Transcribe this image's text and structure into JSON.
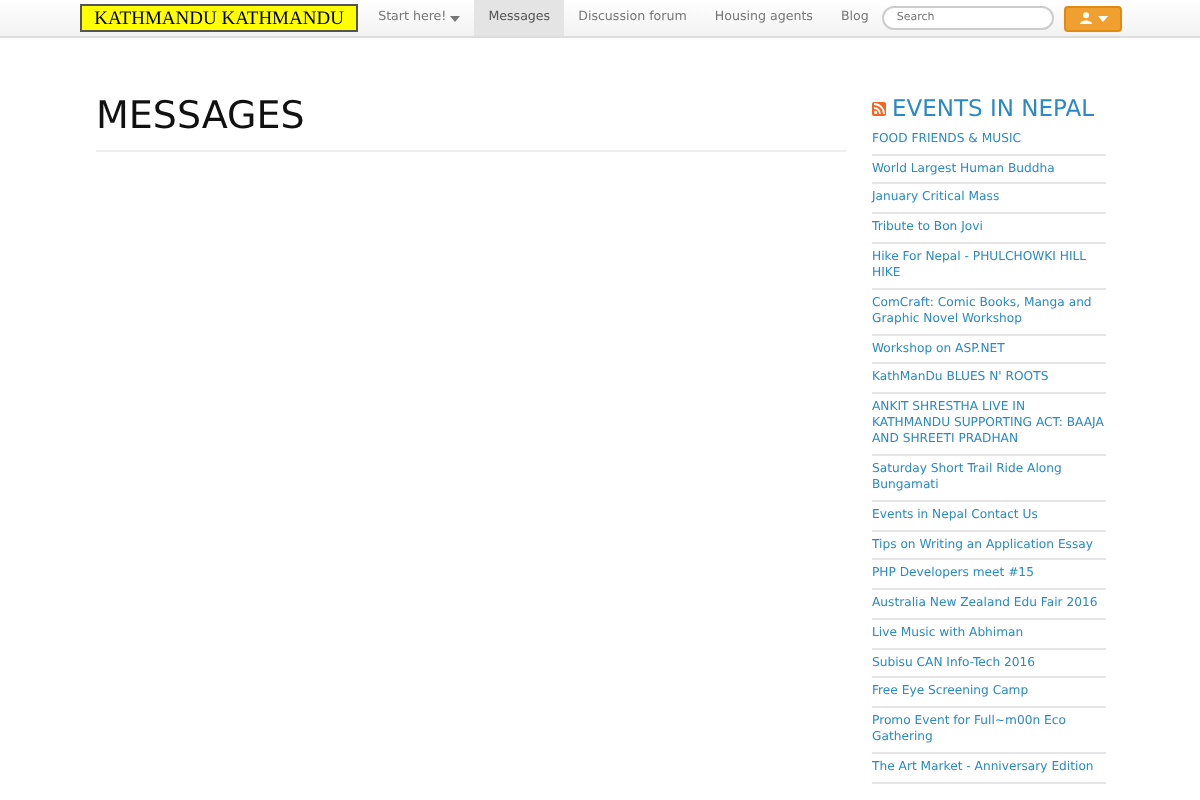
{
  "navbar": {
    "brand": "KATHMANDU KATHMANDU",
    "items": [
      {
        "label": "Start here!",
        "dropdown": true,
        "selected": false
      },
      {
        "label": "Messages",
        "dropdown": false,
        "selected": true
      },
      {
        "label": "Discussion forum",
        "dropdown": false,
        "selected": false
      },
      {
        "label": "Housing agents",
        "dropdown": false,
        "selected": false
      },
      {
        "label": "Blog",
        "dropdown": false,
        "selected": false
      }
    ],
    "search": {
      "placeholder": "Search"
    }
  },
  "page": {
    "title": "MESSAGES"
  },
  "sidebar": {
    "title": "EVENTS IN NEPAL",
    "events": [
      "FOOD FRIENDS & MUSIC",
      "World Largest Human Buddha",
      "January Critical Mass",
      "Tribute to Bon Jovi",
      "Hike For Nepal - PHULCHOWKI HILL HIKE",
      "ComCraft: Comic Books, Manga and Graphic Novel Workshop",
      "Workshop on ASP.NET",
      "KathManDu BLUES N' ROOTS",
      "ANKIT SHRESTHA LIVE IN KATHMANDU SUPPORTING ACT: BAAJA AND SHREETI PRADHAN",
      "Saturday Short Trail Ride Along Bungamati",
      "Events in Nepal Contact Us",
      "Tips on Writing an Application Essay",
      "PHP Developers meet #15",
      "Australia New Zealand Edu Fair 2016",
      "Live Music with Abhiman",
      "Subisu CAN Info-Tech 2016",
      "Free Eye Screening Camp",
      "Promo Event for Full~m00n Eco Gathering",
      "The Art Market - Anniversary Edition"
    ]
  }
}
